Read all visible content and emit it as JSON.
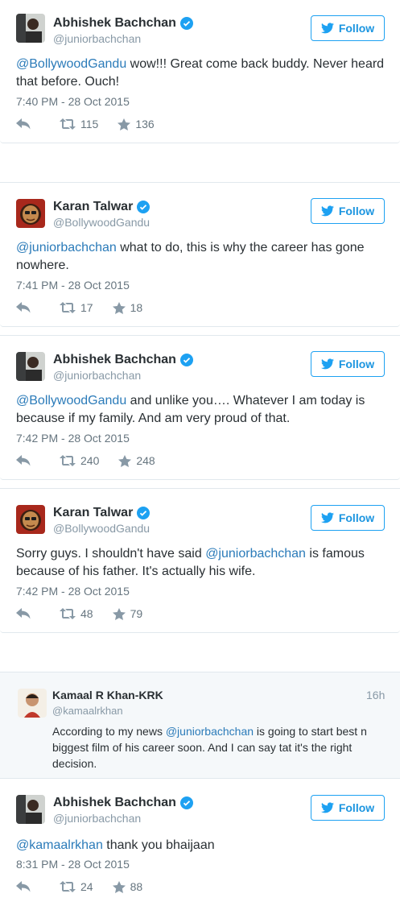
{
  "colors": {
    "link": "#2b7bb9",
    "twitter_blue": "#1da1f2",
    "muted": "#8899a6"
  },
  "tweets": [
    {
      "name": "Abhishek Bachchan",
      "handle": "@juniorbachchan",
      "follow": "Follow",
      "mention": "@BollywoodGandu",
      "text": " wow!!! Great come back buddy. Never heard that before. Ouch!",
      "time": "7:40 PM - 28 Oct 2015",
      "retweets": "115",
      "likes": "136"
    },
    {
      "name": "Karan Talwar",
      "handle": "@BollywoodGandu",
      "follow": "Follow",
      "mention": "@juniorbachchan",
      "text": " what to do, this is why the career has gone nowhere.",
      "time": "7:41 PM - 28 Oct 2015",
      "retweets": "17",
      "likes": "18"
    },
    {
      "name": "Abhishek Bachchan",
      "handle": "@juniorbachchan",
      "follow": "Follow",
      "mention": "@BollywoodGandu",
      "text": " and unlike you…. Whatever I am today is because if my family. And am very proud of that.",
      "time": "7:42 PM - 28 Oct 2015",
      "retweets": "240",
      "likes": "248"
    },
    {
      "name": "Karan Talwar",
      "handle": "@BollywoodGandu",
      "follow": "Follow",
      "text_before": "Sorry guys. I shouldn't have said ",
      "mention": "@juniorbachchan",
      "text_after": " is famous because of his father. It's actually his wife.",
      "time": "7:42 PM - 28 Oct 2015",
      "retweets": "48",
      "likes": "79"
    },
    {
      "name": "Abhishek Bachchan",
      "handle": "@juniorbachchan",
      "follow": "Follow",
      "mention": "@kamaalrkhan",
      "text": " thank you bhaijaan",
      "time": "8:31 PM - 28 Oct 2015",
      "retweets": "24",
      "likes": "88"
    }
  ],
  "quoted": {
    "name": "Kamaal R Khan-KRK",
    "handle": "@kamaalrkhan",
    "time": "16h",
    "text_before": "According to my news ",
    "mention": "@juniorbachchan",
    "text_after": " is going to start best n biggest film of his career soon. And I can say tat it's the right decision."
  }
}
